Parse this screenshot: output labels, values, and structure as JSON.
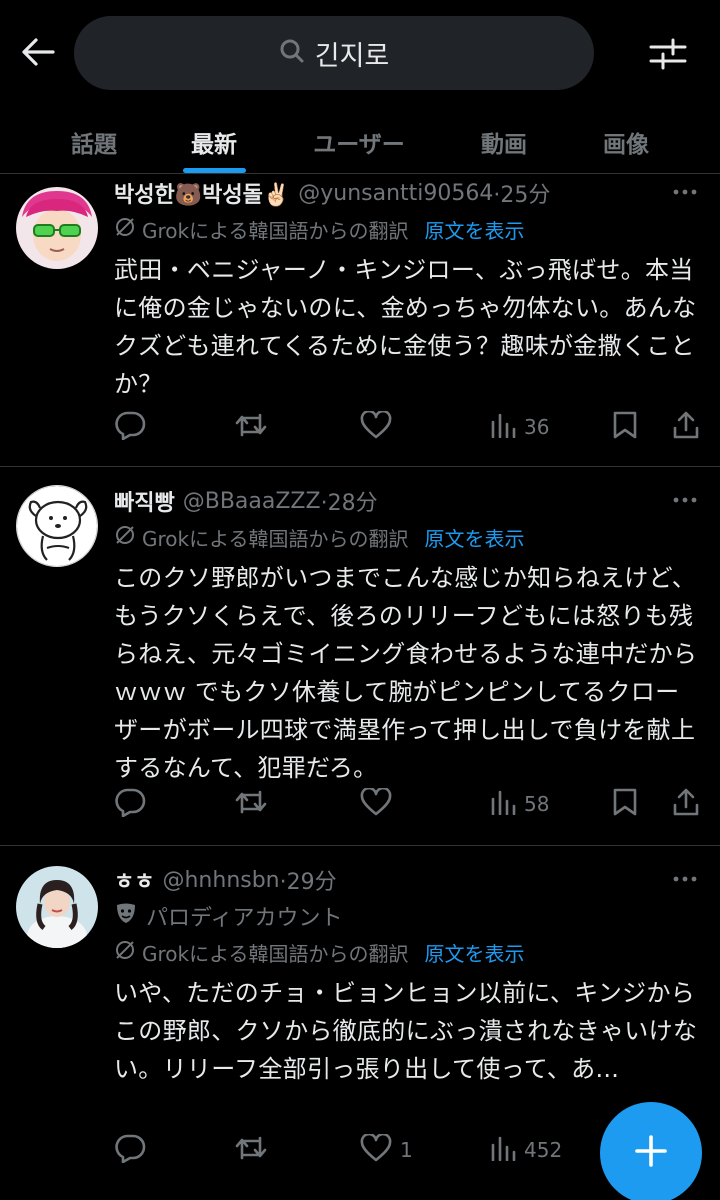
{
  "search": {
    "query": "긴지로"
  },
  "tabs": [
    {
      "label": "話題"
    },
    {
      "label": "最新"
    },
    {
      "label": "ユーザー"
    },
    {
      "label": "動画"
    },
    {
      "label": "画像"
    }
  ],
  "colors": {
    "accent": "#1d9bf0",
    "background": "#000000",
    "muted": "#71767b",
    "divider": "#2f3336"
  },
  "tweets": [
    {
      "name": "박성한🐻박성돌✌🏻",
      "handle": "@yunsantti90564",
      "time": "·25分",
      "translation": "Grokによる韓国語からの翻訳",
      "show_original": "原文を表示",
      "text": "武田・ベニジャーノ・キンジロー、ぶっ飛ばせ。本当に俺の金じゃないのに、金めっちゃ勿体ない。あんなクズども連れてくるために金使う？趣味が金撒くことか？",
      "likes": "",
      "views": "36"
    },
    {
      "name": "빠직빵",
      "handle": "@BBaaaZZZ",
      "time": "·28分",
      "translation": "Grokによる韓国語からの翻訳",
      "show_original": "原文を表示",
      "text": "このクソ野郎がいつまでこんな感じか知らねえけど、もうクソくらえで、後ろのリリーフどもには怒りも残らねえ、元々ゴミイニング食わせるような連中だからｗｗｗ でもクソ休養して腕がピンピンしてるクローザーがボール四球で満塁作って押し出しで負けを献上するなんて、犯罪だろ。",
      "likes": "",
      "views": "58"
    },
    {
      "name": "ㅎㅎ",
      "handle": "@hnhnsbn",
      "time": "·29分",
      "parody": "パロディアカウント",
      "translation": "Grokによる韓国語からの翻訳",
      "show_original": "原文を表示",
      "text": "いや、ただのチョ・ビョンヒョン以前に、キンジからこの野郎、クソから徹底的にぶっ潰されなきゃいけない。リリーフ全部引っ張り出して使って、あ...",
      "likes": "1",
      "views": "452"
    }
  ]
}
